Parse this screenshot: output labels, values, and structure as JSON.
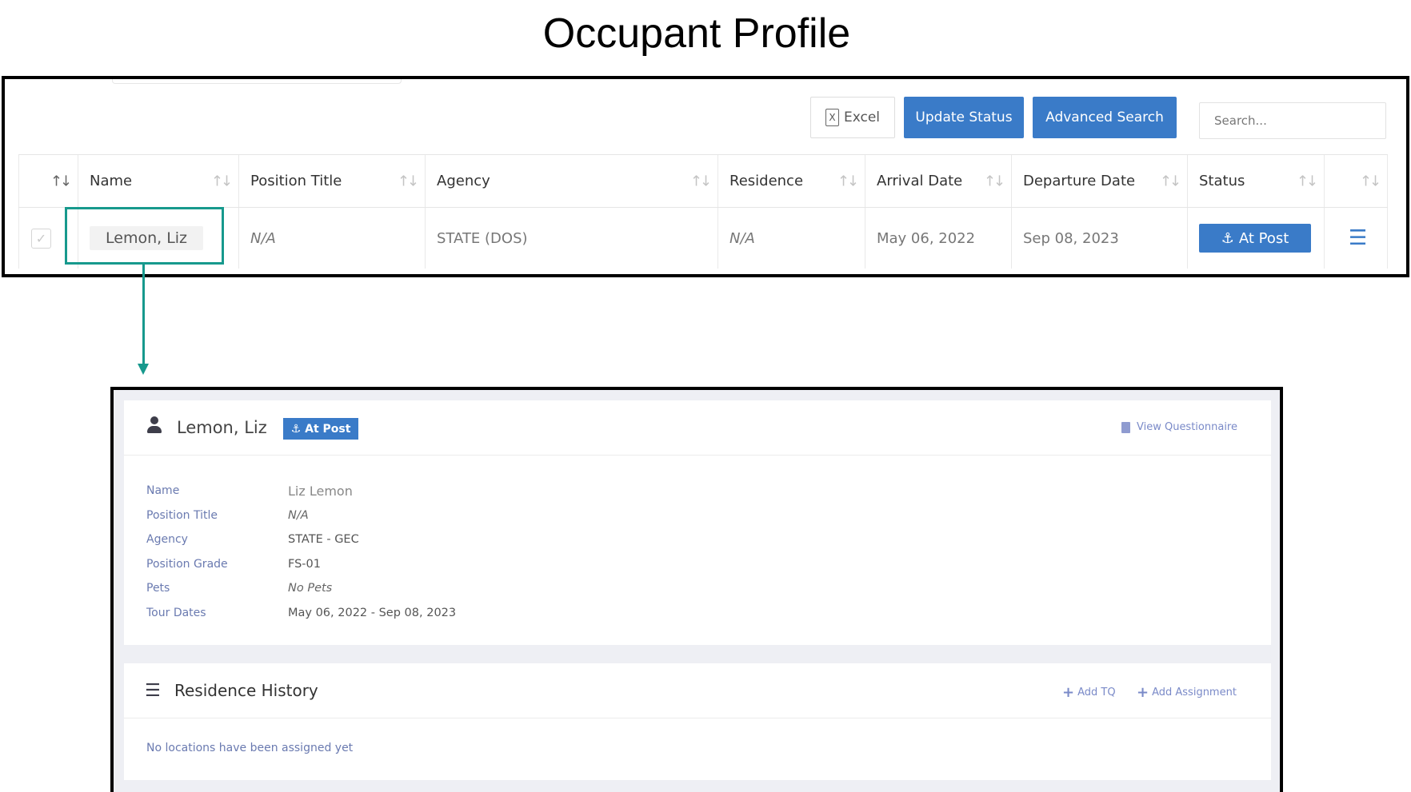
{
  "page": {
    "title": "Occupant Profile"
  },
  "toolbar": {
    "excel_label": "Excel",
    "update_status_label": "Update Status",
    "advanced_search_label": "Advanced Search",
    "search_placeholder": "Search...",
    "accent_color": "#3a7bc8"
  },
  "table": {
    "columns": [
      "",
      "Name",
      "Position Title",
      "Agency",
      "Residence",
      "Arrival Date",
      "Departure Date",
      "Status",
      ""
    ],
    "rows": [
      {
        "checked": true,
        "name": "Lemon, Liz",
        "position_title": "N/A",
        "agency": "STATE (DOS)",
        "residence": "N/A",
        "arrival_date": "May 06, 2022",
        "departure_date": "Sep 08, 2023",
        "status": "At Post"
      }
    ]
  },
  "highlight": {
    "color": "#17998d"
  },
  "profile": {
    "name": "Lemon, Liz",
    "status_badge": "At Post",
    "view_questionnaire": "View Questionnaire",
    "fields": [
      {
        "label": "Name",
        "value": "Liz Lemon"
      },
      {
        "label": "Position Title",
        "value": "N/A"
      },
      {
        "label": "Agency",
        "value": "STATE - GEC"
      },
      {
        "label": "Position Grade",
        "value": "FS-01"
      },
      {
        "label": "Pets",
        "value": "No Pets"
      },
      {
        "label": "Tour Dates",
        "value": "May 06, 2022 - Sep 08, 2023"
      }
    ]
  },
  "residence_history": {
    "title": "Residence History",
    "add_tq": "Add TQ",
    "add_assignment": "Add Assignment",
    "empty_message": "No locations have been assigned yet"
  }
}
